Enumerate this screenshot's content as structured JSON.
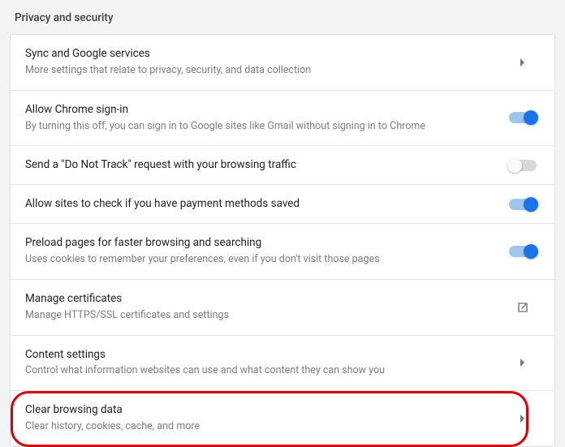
{
  "section_title": "Privacy and security",
  "rows": [
    {
      "title": "Sync and Google services",
      "sub": "More settings that relate to privacy, security, and data collection",
      "action": "chevron"
    },
    {
      "title": "Allow Chrome sign-in",
      "sub": "By turning this off, you can sign in to Google sites like Gmail without signing in to Chrome",
      "action": "toggle-on"
    },
    {
      "title": "Send a \"Do Not Track\" request with your browsing traffic",
      "sub": "",
      "action": "toggle-off"
    },
    {
      "title": "Allow sites to check if you have payment methods saved",
      "sub": "",
      "action": "toggle-on"
    },
    {
      "title": "Preload pages for faster browsing and searching",
      "sub": "Uses cookies to remember your preferences, even if you don't visit those pages",
      "action": "toggle-on"
    },
    {
      "title": "Manage certificates",
      "sub": "Manage HTTPS/SSL certificates and settings",
      "action": "external"
    },
    {
      "title": "Content settings",
      "sub": "Control what information websites can use and what content they can show you",
      "action": "chevron"
    },
    {
      "title": "Clear browsing data",
      "sub": "Clear history, cookies, cache, and more",
      "action": "chevron",
      "highlighted": true
    }
  ]
}
